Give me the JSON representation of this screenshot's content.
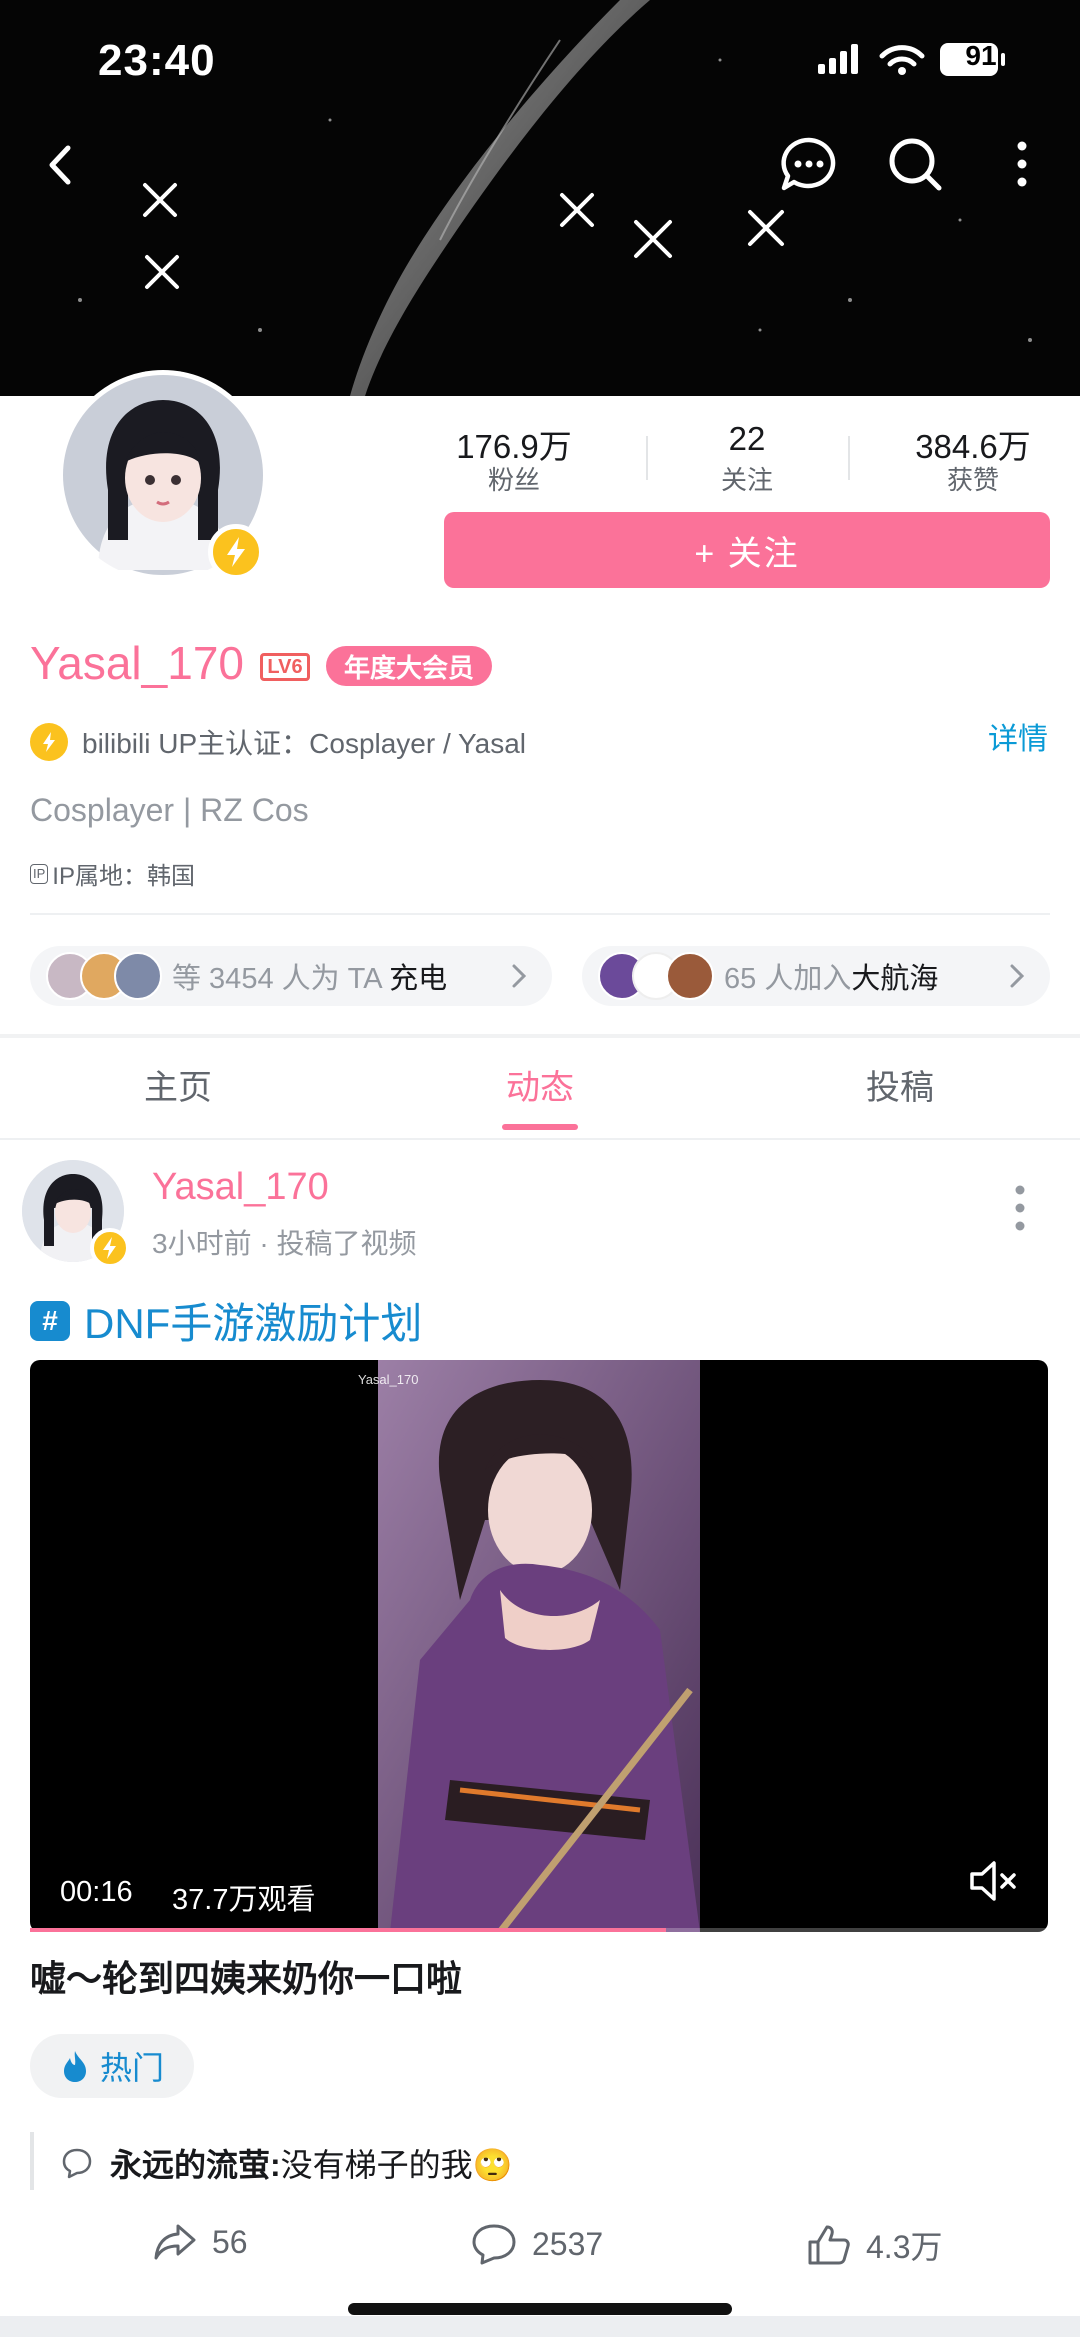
{
  "status_bar": {
    "time": "23:40",
    "battery": "91"
  },
  "top_bar": {
    "icons": [
      "back-arrow-icon",
      "chat-bubble-icon",
      "search-icon",
      "more-vertical-icon"
    ]
  },
  "profile": {
    "stats": [
      {
        "value": "176.9万",
        "label": "粉丝"
      },
      {
        "value": "22",
        "label": "关注"
      },
      {
        "value": "384.6万",
        "label": "获赞"
      }
    ],
    "follow_label": "+ 关注",
    "username": "Yasal_170",
    "level": "LV6",
    "vip_label": "年度大会员",
    "certification": "bilibili UP主认证：Cosplayer / Yasal",
    "detail_label": "详情",
    "bio": "Cosplayer | RZ Cos",
    "ip_chip": "IP",
    "ip_location": "IP属地：韩国",
    "charge": {
      "prefix": "等 3454 人为 TA ",
      "emphasis": "充电"
    },
    "guard": {
      "prefix": "65 人加入",
      "emphasis": "大航海"
    }
  },
  "tabs": [
    {
      "label": "主页",
      "active": false
    },
    {
      "label": "动态",
      "active": true
    },
    {
      "label": "投稿",
      "active": false
    }
  ],
  "post": {
    "author": "Yasal_170",
    "meta": "3小时前 · 投稿了视频",
    "topic": "DNF手游激励计划",
    "video": {
      "watermark": "Yasal_170",
      "duration": "00:16",
      "views": "37.7万观看",
      "progress": 0.625
    },
    "title": "嘘～轮到四姨来奶你一口啦",
    "hot_label": "热门",
    "comment": {
      "user": "永远的流萤:",
      "text": " 没有梯子的我🙄"
    },
    "actions": {
      "share": "56",
      "comment": "2537",
      "like": "4.3万"
    }
  },
  "colors": {
    "brand_pink": "#fb7299",
    "link_blue": "#178bcf",
    "badge_yellow": "#fbc21e"
  }
}
